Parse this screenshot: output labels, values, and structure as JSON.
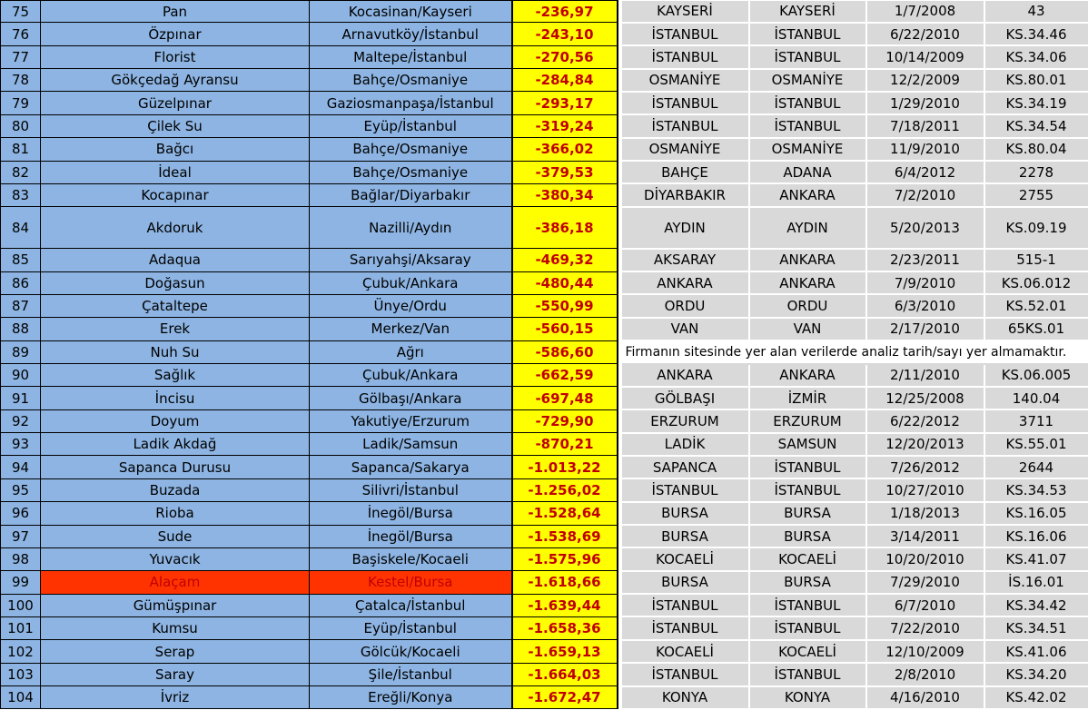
{
  "rows": [
    {
      "no": "75",
      "name": "Pan",
      "loc": "Kocasinan/Kayseri",
      "val": "-236,97",
      "c1": "KAYSERİ",
      "c2": "KAYSERİ",
      "date": "1/7/2008",
      "code": "43"
    },
    {
      "no": "76",
      "name": "Özpınar",
      "loc": "Arnavutköy/İstanbul",
      "val": "-243,10",
      "c1": "İSTANBUL",
      "c2": "İSTANBUL",
      "date": "6/22/2010",
      "code": "KS.34.46"
    },
    {
      "no": "77",
      "name": "Florist",
      "loc": "Maltepe/İstanbul",
      "val": "-270,56",
      "c1": "İSTANBUL",
      "c2": "İSTANBUL",
      "date": "10/14/2009",
      "code": "KS.34.06"
    },
    {
      "no": "78",
      "name": "Gökçedağ Ayransu",
      "loc": "Bahçe/Osmaniye",
      "val": "-284,84",
      "c1": "OSMANİYE",
      "c2": "OSMANİYE",
      "date": "12/2/2009",
      "code": "KS.80.01"
    },
    {
      "no": "79",
      "name": "Güzelpınar",
      "loc": "Gaziosmanpaşa/İstanbul",
      "val": "-293,17",
      "c1": "İSTANBUL",
      "c2": "İSTANBUL",
      "date": "1/29/2010",
      "code": "KS.34.19"
    },
    {
      "no": "80",
      "name": "Çilek Su",
      "loc": "Eyüp/İstanbul",
      "val": "-319,24",
      "c1": "İSTANBUL",
      "c2": "İSTANBUL",
      "date": "7/18/2011",
      "code": "KS.34.54"
    },
    {
      "no": "81",
      "name": "Bağcı",
      "loc": "Bahçe/Osmaniye",
      "val": "-366,02",
      "c1": "OSMANİYE",
      "c2": "OSMANİYE",
      "date": "11/9/2010",
      "code": "KS.80.04"
    },
    {
      "no": "82",
      "name": "İdeal",
      "loc": "Bahçe/Osmaniye",
      "val": "-379,53",
      "c1": "BAHÇE",
      "c2": "ADANA",
      "date": "6/4/2012",
      "code": "2278"
    },
    {
      "no": "83",
      "name": "Kocapınar",
      "loc": "Bağlar/Diyarbakır",
      "val": "-380,34",
      "c1": "DİYARBAKIR",
      "c2": "ANKARA",
      "date": "7/2/2010",
      "code": "2755"
    },
    {
      "no": "84",
      "name": "Akdoruk",
      "loc": "Nazilli/Aydın",
      "val": "-386,18",
      "c1": "AYDIN",
      "c2": "AYDIN",
      "date": "5/20/2013",
      "code": "KS.09.19",
      "tall": true
    },
    {
      "no": "85",
      "name": "Adaqua",
      "loc": "Sarıyahşi/Aksaray",
      "val": "-469,32",
      "c1": "AKSARAY",
      "c2": "ANKARA",
      "date": "2/23/2011",
      "code": "515-1"
    },
    {
      "no": "86",
      "name": "Doğasun",
      "loc": "Çubuk/Ankara",
      "val": "-480,44",
      "c1": "ANKARA",
      "c2": "ANKARA",
      "date": "7/9/2010",
      "code": "KS.06.012"
    },
    {
      "no": "87",
      "name": "Çataltepe",
      "loc": "Ünye/Ordu",
      "val": "-550,99",
      "c1": "ORDU",
      "c2": "ORDU",
      "date": "6/3/2010",
      "code": "KS.52.01"
    },
    {
      "no": "88",
      "name": "Erek",
      "loc": "Merkez/Van",
      "val": "-560,15",
      "c1": "VAN",
      "c2": "VAN",
      "date": "2/17/2010",
      "code": "65KS.01"
    },
    {
      "no": "89",
      "name": "Nuh Su",
      "loc": "Ağrı",
      "val": "-586,60",
      "note": "Firmanın sitesinde yer alan verilerde analiz tarih/sayı yer almamaktır."
    },
    {
      "no": "90",
      "name": "Sağlık",
      "loc": "Çubuk/Ankara",
      "val": "-662,59",
      "c1": "ANKARA",
      "c2": "ANKARA",
      "date": "2/11/2010",
      "code": "KS.06.005"
    },
    {
      "no": "91",
      "name": "İncisu",
      "loc": "Gölbaşı/Ankara",
      "val": "-697,48",
      "c1": "GÖLBAŞI",
      "c2": "İZMİR",
      "date": "12/25/2008",
      "code": "140.04"
    },
    {
      "no": "92",
      "name": "Doyum",
      "loc": "Yakutiye/Erzurum",
      "val": "-729,90",
      "c1": "ERZURUM",
      "c2": "ERZURUM",
      "date": "6/22/2012",
      "code": "3711"
    },
    {
      "no": "93",
      "name": "Ladik Akdağ",
      "loc": "Ladik/Samsun",
      "val": "-870,21",
      "c1": "LADİK",
      "c2": "SAMSUN",
      "date": "12/20/2013",
      "code": "KS.55.01"
    },
    {
      "no": "94",
      "name": "Sapanca Durusu",
      "loc": "Sapanca/Sakarya",
      "val": "-1.013,22",
      "c1": "SAPANCA",
      "c2": "İSTANBUL",
      "date": "7/26/2012",
      "code": "2644"
    },
    {
      "no": "95",
      "name": "Buzada",
      "loc": "Silivri/İstanbul",
      "val": "-1.256,02",
      "c1": "İSTANBUL",
      "c2": "İSTANBUL",
      "date": "10/27/2010",
      "code": "KS.34.53"
    },
    {
      "no": "96",
      "name": "Rioba",
      "loc": "İnegöl/Bursa",
      "val": "-1.528,64",
      "c1": "BURSA",
      "c2": "BURSA",
      "date": "1/18/2013",
      "code": "KS.16.05"
    },
    {
      "no": "97",
      "name": "Sude",
      "loc": "İnegöl/Bursa",
      "val": "-1.538,69",
      "c1": "BURSA",
      "c2": "BURSA",
      "date": "3/14/2011",
      "code": "KS.16.06"
    },
    {
      "no": "98",
      "name": "Yuvacık",
      "loc": "Başiskele/Kocaeli",
      "val": "-1.575,96",
      "c1": "KOCAELİ",
      "c2": "KOCAELİ",
      "date": "10/20/2010",
      "code": "KS.41.07"
    },
    {
      "no": "99",
      "name": "Alaçam",
      "loc": "Kestel/Bursa",
      "val": "-1.618,66",
      "c1": "BURSA",
      "c2": "BURSA",
      "date": "7/29/2010",
      "code": "İS.16.01",
      "hl": true
    },
    {
      "no": "100",
      "name": "Gümüşpınar",
      "loc": "Çatalca/İstanbul",
      "val": "-1.639,44",
      "c1": "İSTANBUL",
      "c2": "İSTANBUL",
      "date": "6/7/2010",
      "code": "KS.34.42"
    },
    {
      "no": "101",
      "name": "Kumsu",
      "loc": "Eyüp/İstanbul",
      "val": "-1.658,36",
      "c1": "İSTANBUL",
      "c2": "İSTANBUL",
      "date": "7/22/2010",
      "code": "KS.34.51"
    },
    {
      "no": "102",
      "name": "Serap",
      "loc": "Gölcük/Kocaeli",
      "val": "-1.659,13",
      "c1": "KOCAELİ",
      "c2": "KOCAELİ",
      "date": "12/10/2009",
      "code": "KS.41.06"
    },
    {
      "no": "103",
      "name": "Saray",
      "loc": "Şile/İstanbul",
      "val": "-1.664,03",
      "c1": "İSTANBUL",
      "c2": "İSTANBUL",
      "date": "2/8/2010",
      "code": "KS.34.20"
    },
    {
      "no": "104",
      "name": "İvriz",
      "loc": "Ereğli/Konya",
      "val": "-1.672,47",
      "c1": "KONYA",
      "c2": "KONYA",
      "date": "4/16/2010",
      "code": "KS.42.02"
    }
  ]
}
